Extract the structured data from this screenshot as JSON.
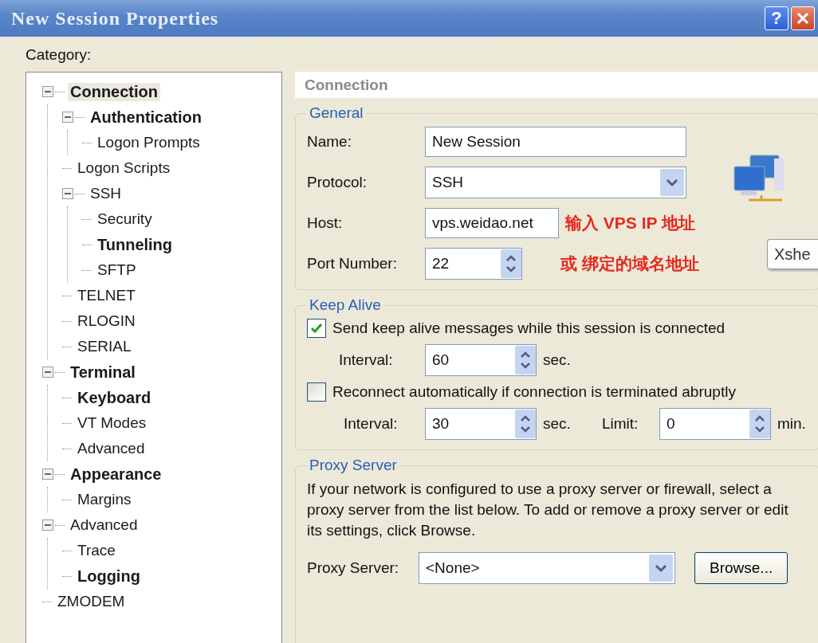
{
  "window": {
    "title": "New Session Properties",
    "help_button": "?"
  },
  "category_label": "Category:",
  "tree": [
    {
      "label": "Connection",
      "bold": true,
      "selected": true,
      "expanded": true,
      "children": [
        {
          "label": "Authentication",
          "bold": true,
          "selected": false,
          "expanded": true,
          "children": [
            {
              "label": "Logon Prompts",
              "bold": false,
              "selected": false
            }
          ]
        },
        {
          "label": "Logon Scripts",
          "bold": false,
          "selected": false
        },
        {
          "label": "SSH",
          "bold": false,
          "selected": false,
          "expanded": true,
          "children": [
            {
              "label": "Security",
              "bold": false,
              "selected": false
            },
            {
              "label": "Tunneling",
              "bold": true,
              "selected": false
            },
            {
              "label": "SFTP",
              "bold": false,
              "selected": false
            }
          ]
        },
        {
          "label": "TELNET",
          "bold": false,
          "selected": false
        },
        {
          "label": "RLOGIN",
          "bold": false,
          "selected": false
        },
        {
          "label": "SERIAL",
          "bold": false,
          "selected": false
        }
      ]
    },
    {
      "label": "Terminal",
      "bold": true,
      "selected": false,
      "expanded": true,
      "children": [
        {
          "label": "Keyboard",
          "bold": true,
          "selected": false
        },
        {
          "label": "VT Modes",
          "bold": false,
          "selected": false
        },
        {
          "label": "Advanced",
          "bold": false,
          "selected": false
        }
      ]
    },
    {
      "label": "Appearance",
      "bold": true,
      "selected": false,
      "expanded": true,
      "children": [
        {
          "label": "Margins",
          "bold": false,
          "selected": false
        }
      ]
    },
    {
      "label": "Advanced",
      "bold": false,
      "selected": false,
      "expanded": true,
      "children": [
        {
          "label": "Trace",
          "bold": false,
          "selected": false
        },
        {
          "label": "Logging",
          "bold": true,
          "selected": false
        }
      ]
    },
    {
      "label": "ZMODEM",
      "bold": false,
      "selected": false
    }
  ],
  "panel_title": "Connection",
  "general": {
    "title": "General",
    "name_label": "Name:",
    "name_value": "New Session",
    "protocol_label": "Protocol:",
    "protocol_value": "SSH",
    "host_label": "Host:",
    "host_value": "vps.weidao.net",
    "port_label": "Port Number:",
    "port_value": "22",
    "annotations": [
      "输入 VPS IP 地址",
      "或 绑定的域名地址"
    ]
  },
  "tooltip": "Xshe",
  "keep_alive": {
    "title": "Keep Alive",
    "send": {
      "label": "Send keep alive messages while this session is connected",
      "checked": true,
      "interval_label": "Interval:",
      "interval_value": "60",
      "unit": "sec."
    },
    "reconnect": {
      "label": "Reconnect automatically if connection is terminated abruptly",
      "checked": false,
      "interval_label": "Interval:",
      "interval_value": "30",
      "unit": "sec.",
      "limit_label": "Limit:",
      "limit_value": "0",
      "limit_unit": "min."
    }
  },
  "proxy": {
    "title": "Proxy Server",
    "description": "If your network is configured to use a proxy server or firewall, select a proxy server from the list below. To add or remove a proxy server or edit its settings, click Browse.",
    "server_label": "Proxy Server:",
    "server_value": "<None>",
    "browse_button": "Browse..."
  }
}
